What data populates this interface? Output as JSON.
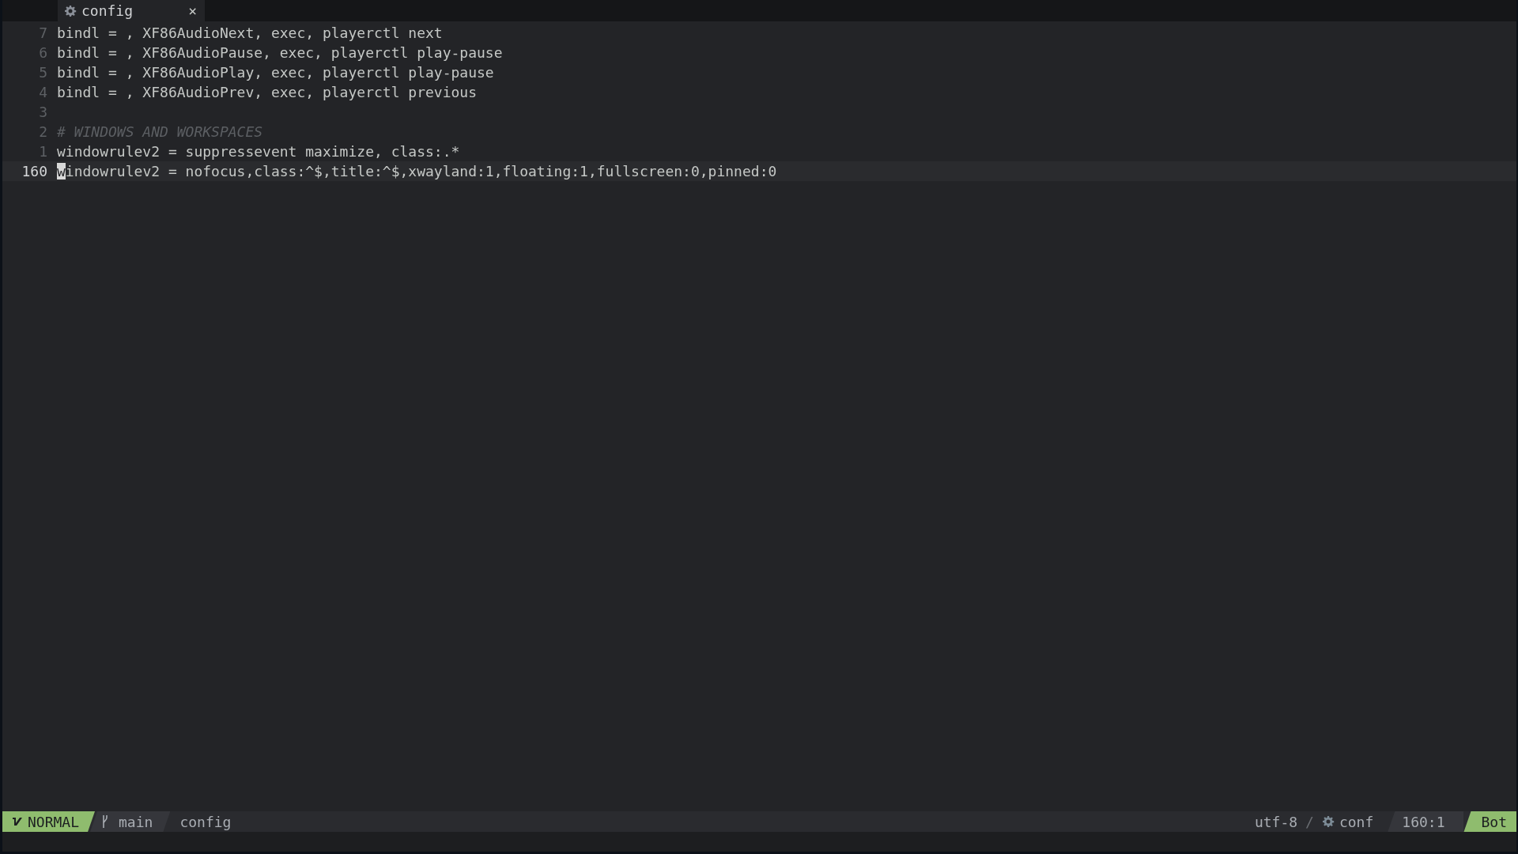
{
  "tabs": [
    {
      "label": "config",
      "selected": true,
      "close": "×"
    }
  ],
  "lines": [
    {
      "number": "7",
      "text": "bindl = , XF86AudioNext, exec, playerctl next",
      "kind": "code",
      "current": false
    },
    {
      "number": "6",
      "text": "bindl = , XF86AudioPause, exec, playerctl play-pause",
      "kind": "code",
      "current": false
    },
    {
      "number": "5",
      "text": "bindl = , XF86AudioPlay, exec, playerctl play-pause",
      "kind": "code",
      "current": false
    },
    {
      "number": "4",
      "text": "bindl = , XF86AudioPrev, exec, playerctl previous",
      "kind": "code",
      "current": false
    },
    {
      "number": "3",
      "current": false
    },
    {
      "number": "2",
      "text": "# WINDOWS AND WORKSPACES",
      "kind": "comment",
      "current": false
    },
    {
      "number": "1",
      "text": "windowrulev2 = suppressevent maximize, class:.*",
      "kind": "code",
      "current": false
    },
    {
      "number": "160",
      "text": "windowrulev2 = nofocus,class:^$,title:^$,xwayland:1,floating:1,fullscreen:0,pinned:0",
      "kind": "code",
      "current": true
    }
  ],
  "status_bar": {
    "mode": "NORMAL",
    "branch": "main",
    "file": "config",
    "encoding": "utf-8",
    "separator": "/",
    "filetype": "conf",
    "position": "160:1",
    "scroll": "Bot"
  }
}
